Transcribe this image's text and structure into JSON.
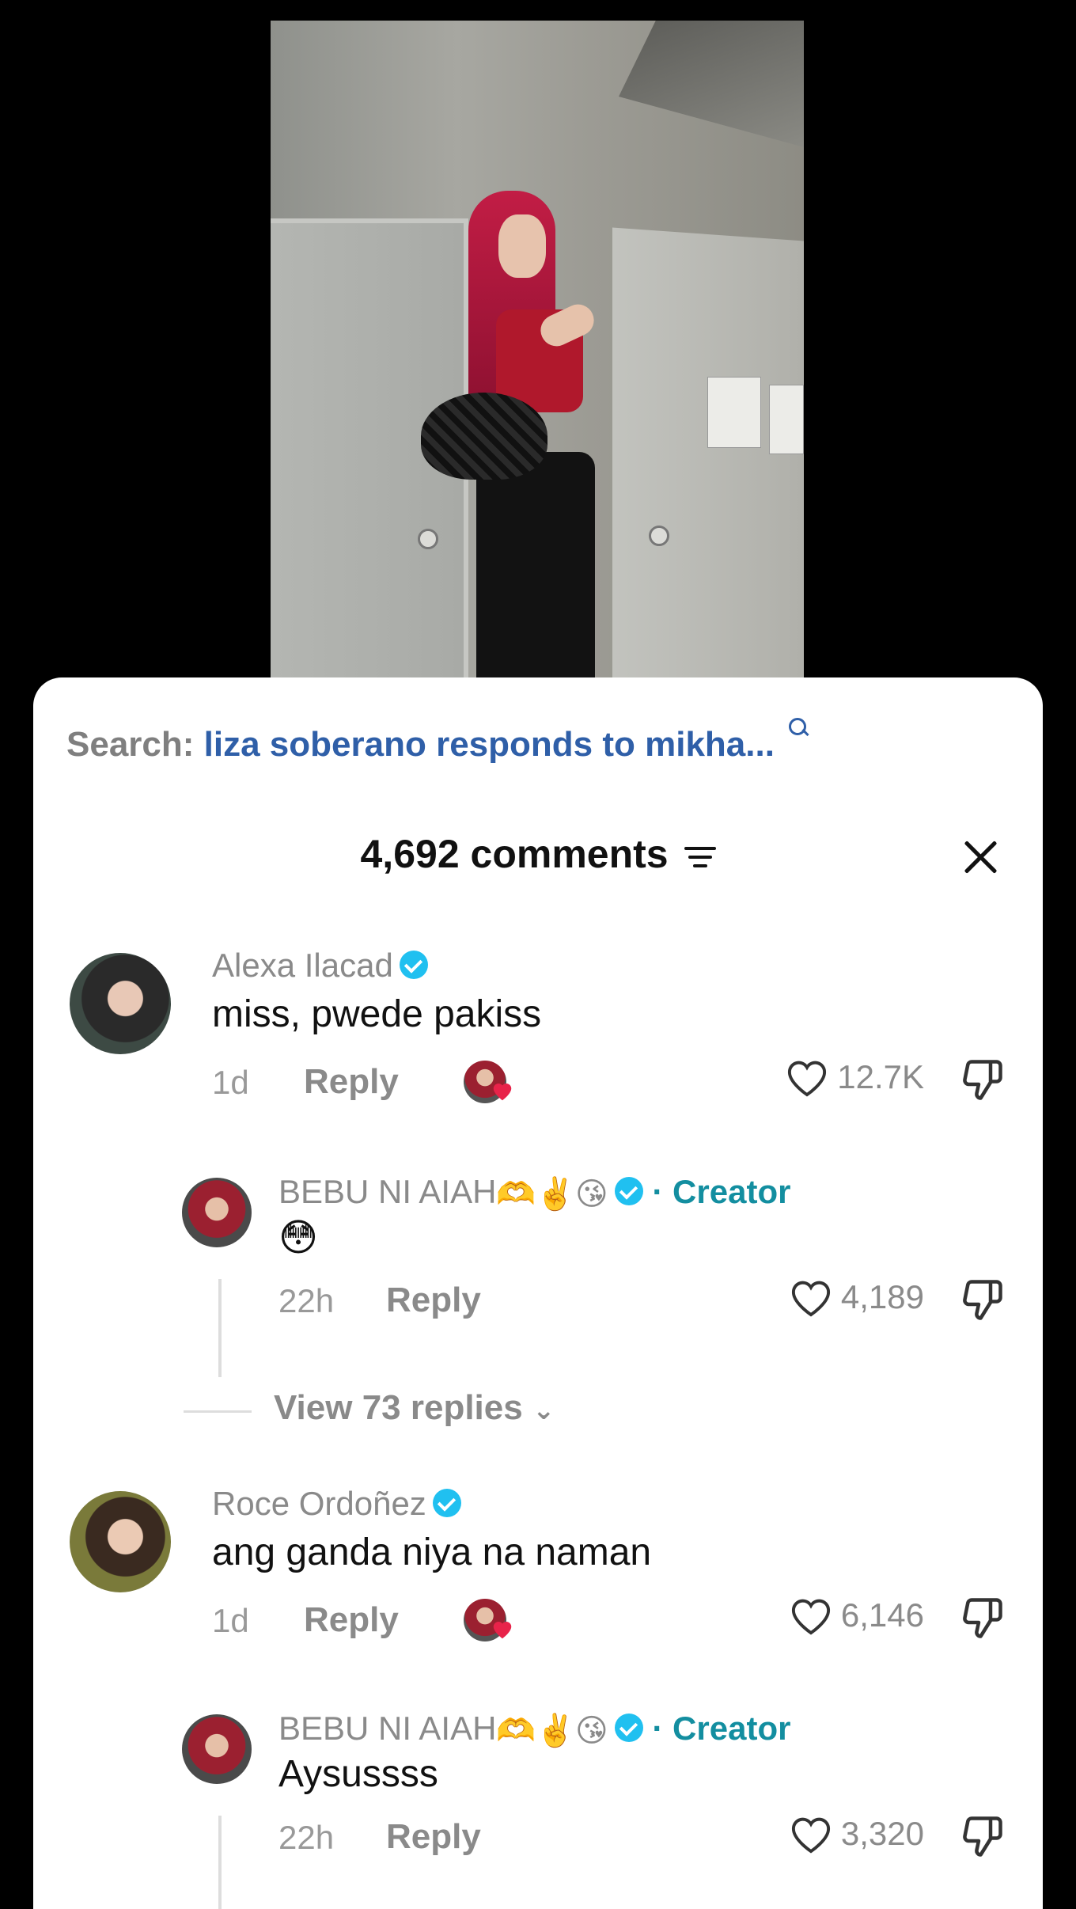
{
  "search": {
    "label": "Search:",
    "query": "liza soberano responds to mikha..."
  },
  "header": {
    "count": "4,692 comments"
  },
  "comments": [
    {
      "name": "Alexa Ilacad",
      "text": "miss, pwede pakiss",
      "time": "1d",
      "reply": "Reply",
      "likes": "12.7K"
    },
    {
      "name": "BEBU NI AIAH",
      "creator": "· Creator",
      "text": "😳",
      "time": "22h",
      "reply": "Reply",
      "likes": "4,189"
    },
    {
      "name": "Roce Ordoñez",
      "text": "ang ganda niya na naman",
      "time": "1d",
      "reply": "Reply",
      "likes": "6,146"
    },
    {
      "name": "BEBU NI AIAH",
      "creator": "· Creator",
      "text": "Aysussss",
      "time": "22h",
      "reply": "Reply",
      "likes": "3,320"
    }
  ],
  "view_replies": "View 73 replies",
  "name_emojis": "🫶✌️😘",
  "colors": {
    "link": "#2f5fa8",
    "creator": "#138ea0",
    "verified": "#20c0f0",
    "accent_heart": "#e8234a"
  }
}
